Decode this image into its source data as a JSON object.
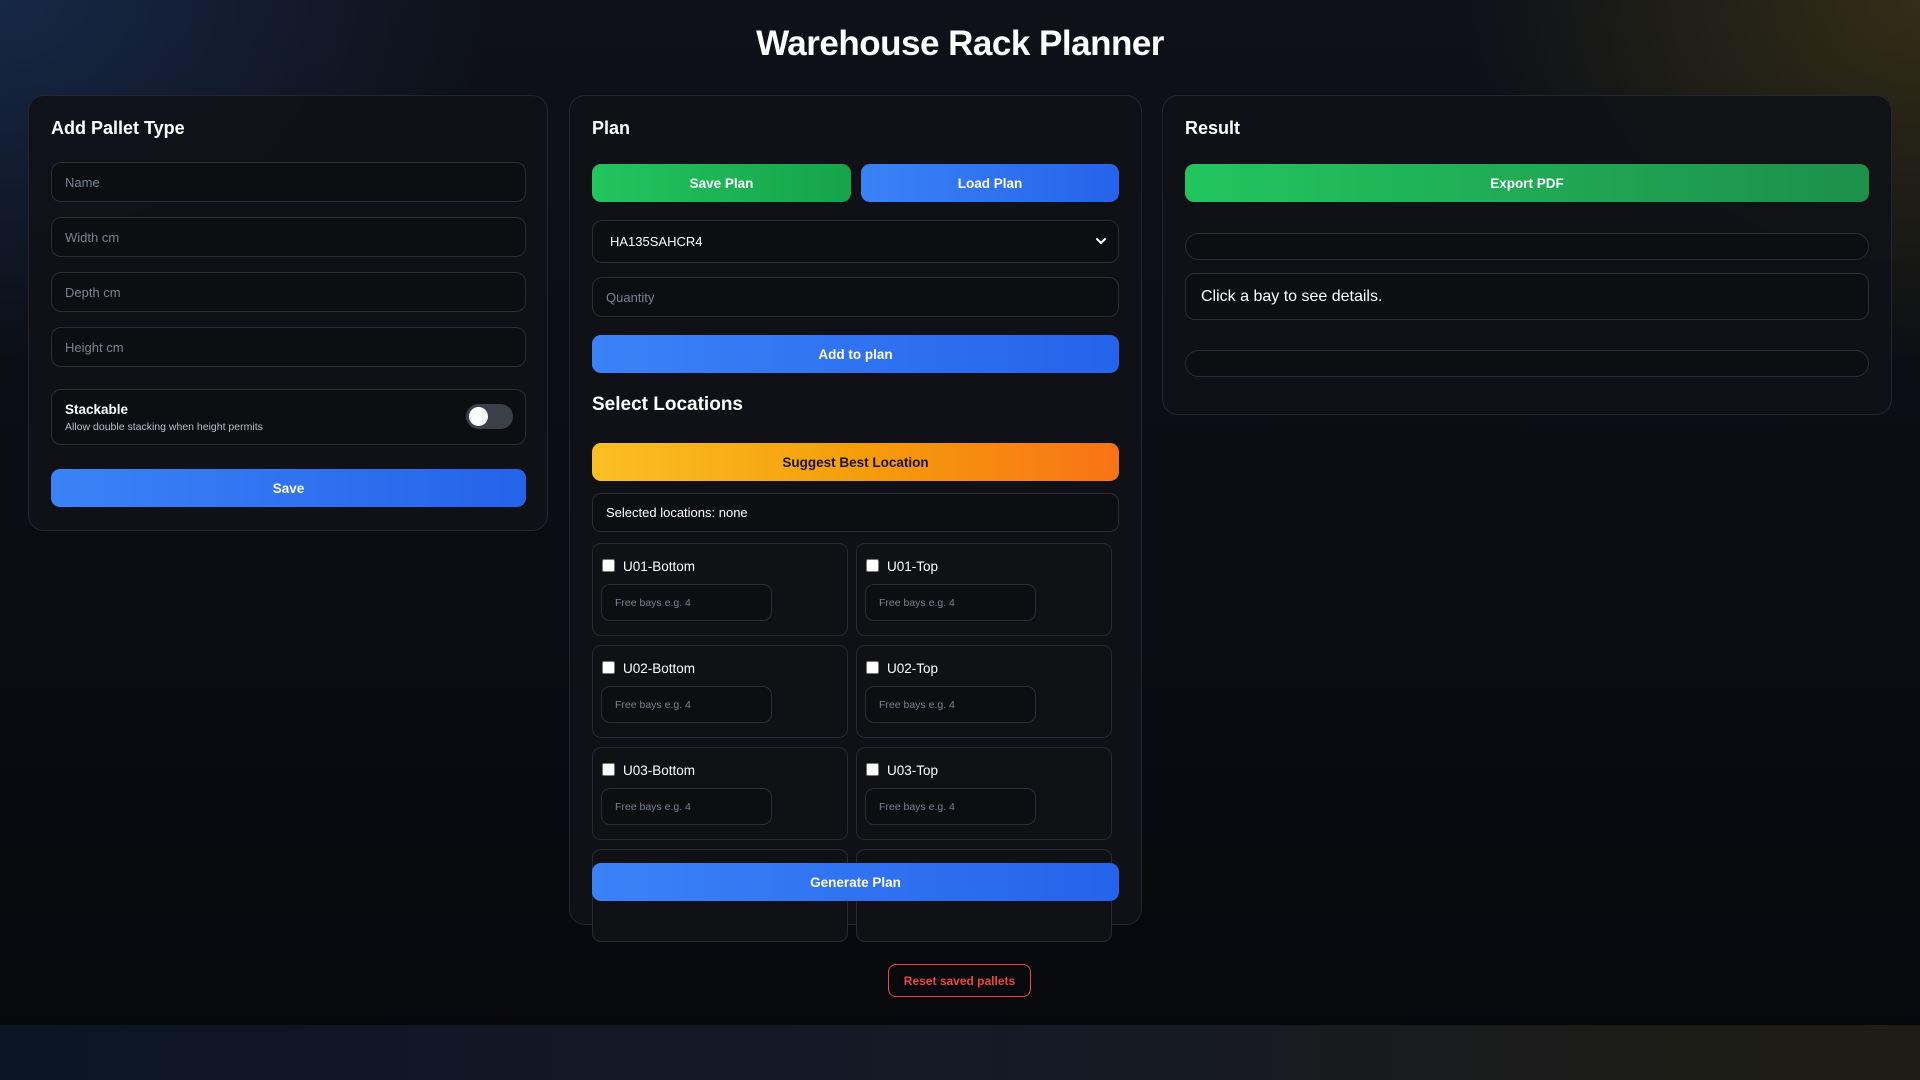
{
  "app": {
    "title": "Warehouse Rack Planner",
    "colors": {
      "blue": "#3b82f6",
      "green": "#22c55e",
      "orange": "#f59e0b",
      "danger": "#ef4444",
      "card": "#101217"
    }
  },
  "add_pallet": {
    "title": "Add Pallet Type",
    "name_placeholder": "Name",
    "width_placeholder": "Width cm",
    "depth_placeholder": "Depth cm",
    "height_placeholder": "Height cm",
    "stackable_label": "Stackable",
    "stackable_desc": "Allow double stacking when height permits",
    "stackable_on": false,
    "save_label": "Save"
  },
  "plan": {
    "title": "Plan",
    "save_plan_label": "Save Plan",
    "load_plan_label": "Load Plan",
    "pallet_select_value": "HA135SAHCR4",
    "quantity_placeholder": "Quantity",
    "add_to_plan_label": "Add to plan",
    "select_locations_title": "Select Locations",
    "suggest_label": "Suggest Best Location",
    "selected_locations_text": "Selected locations: none",
    "free_bays_placeholder": "Free bays e.g. 4",
    "locations": [
      {
        "name": "U01-Bottom"
      },
      {
        "name": "U01-Top"
      },
      {
        "name": "U02-Bottom"
      },
      {
        "name": "U02-Top"
      },
      {
        "name": "U03-Bottom"
      },
      {
        "name": "U03-Top"
      },
      {
        "name": ""
      },
      {
        "name": ""
      }
    ],
    "generate_label": "Generate Plan"
  },
  "result": {
    "title": "Result",
    "export_label": "Export PDF",
    "detail_text": "Click a bay to see details."
  },
  "footer": {
    "reset_label": "Reset saved pallets"
  }
}
